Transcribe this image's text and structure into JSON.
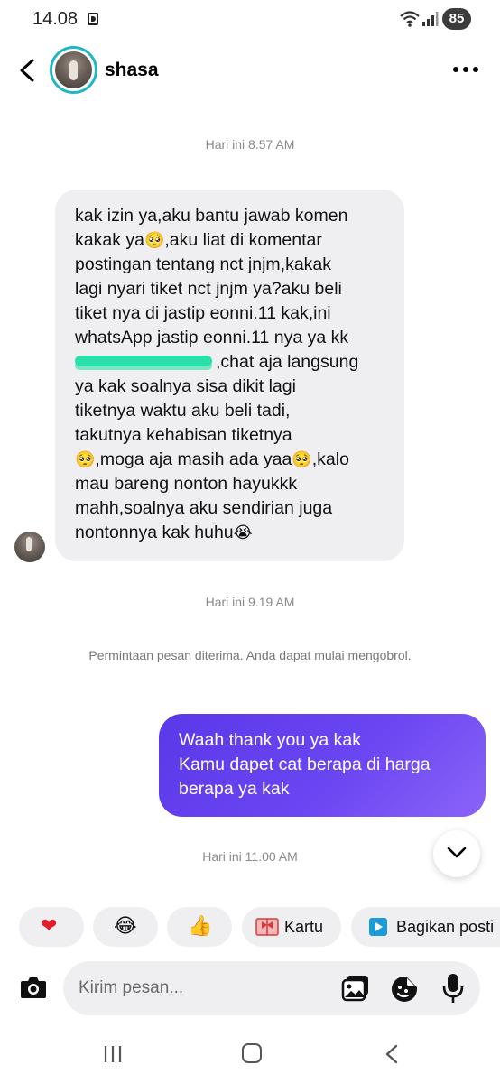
{
  "status_bar": {
    "time": "14.08",
    "battery": "85"
  },
  "header": {
    "contact_name": "shasa"
  },
  "timestamps": {
    "first": "Hari ini 8.57 AM",
    "second": "Hari ini 9.19 AM",
    "third": "Hari ini 11.00 AM"
  },
  "incoming": {
    "lines": [
      "kak izin ya,aku bantu jawab komen",
      "kakak ya",
      ",aku liat di komentar",
      "postingan tentang nct jnjm,kakak",
      "lagi nyari tiket nct jnjm ya?aku beli",
      "tiket nya di jastip eonni.11 kak,ini",
      "whatsApp jastip eonni.11 nya ya kk",
      ",chat aja langsung",
      "ya kak soalnya sisa dikit lagi",
      "tiketnya waktu aku beli tadi,",
      "takutnya kehabisan tiketnya",
      ",moga aja masih ada yaa",
      ",kalo",
      "mau bareng nonton hayukkk",
      "mahh,soalnya aku sendirian juga",
      "nontonnya kak huhu"
    ],
    "emoji_pleading": "🥺",
    "emoji_crying": "😭"
  },
  "system_note": "Permintaan pesan diterima. Anda dapat mulai mengobrol.",
  "outgoing": {
    "lines": [
      "Waah thank you ya kak",
      "Kamu dapet cat berapa di harga",
      "berapa ya kak"
    ]
  },
  "quick_replies": {
    "heart": "❤",
    "laugh": "😂",
    "thumbs": "👍",
    "card_label": "Kartu",
    "share_label": "Bagikan posti"
  },
  "composer": {
    "placeholder": "Kirim pesan..."
  },
  "colors": {
    "accent_ring": "#1fb6c6",
    "outgoing_bubble": "#6a45f2",
    "incoming_bubble": "#efeff1",
    "redaction": "#28e0a8"
  },
  "icons": {
    "back": "chevron-left-icon",
    "more": "more-horizontal-icon",
    "scroll": "chevron-down-icon",
    "camera": "camera-icon",
    "gallery": "gallery-icon",
    "sticker": "sticker-icon",
    "mic": "mic-icon"
  }
}
